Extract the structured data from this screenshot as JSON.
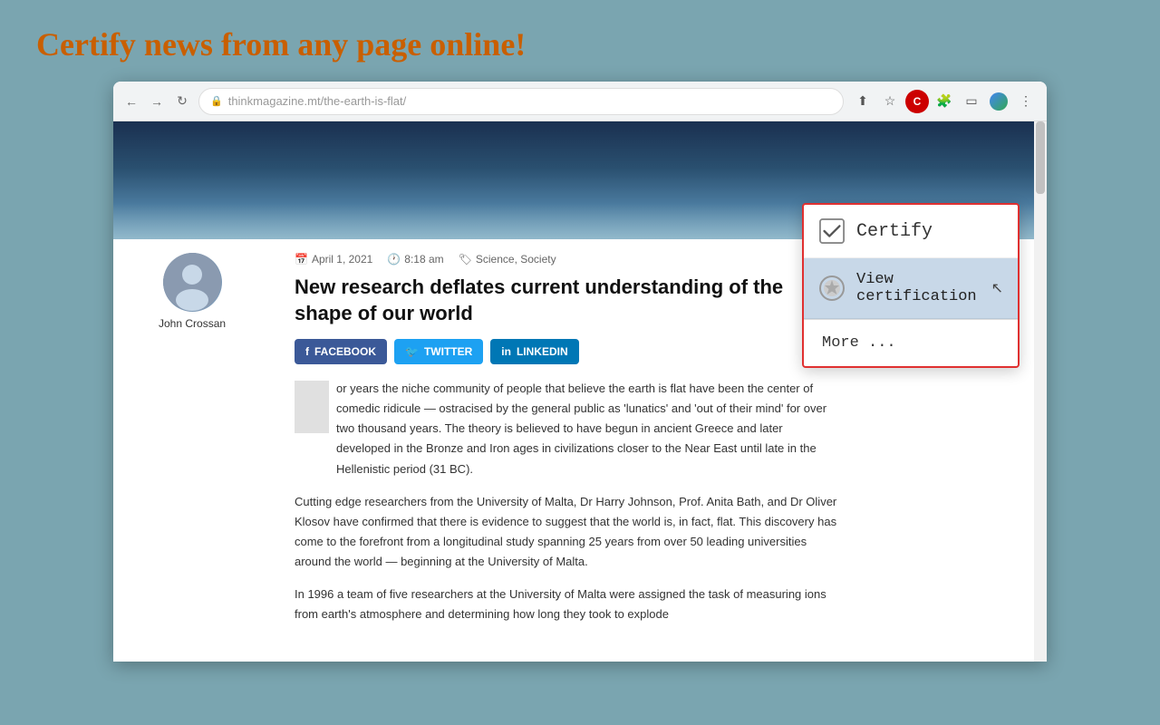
{
  "page": {
    "headline": "Certify news from any page online!"
  },
  "browser": {
    "back_label": "←",
    "forward_label": "→",
    "refresh_label": "↻",
    "address": "thinkmagazine.mt/the-earth-is-flat/",
    "address_prefix": "thinkmagazine.mt",
    "address_suffix": "/the-earth-is-flat/"
  },
  "article": {
    "author_name": "John Crossan",
    "date": "April 1, 2021",
    "time": "8:18 am",
    "categories": "Science, Society",
    "title": "New research deflates current understanding of the shape of our world",
    "share_buttons": [
      {
        "label": "FACEBOOK",
        "type": "facebook"
      },
      {
        "label": "TWITTER",
        "type": "twitter"
      },
      {
        "label": "LINKEDIN",
        "type": "linkedin"
      }
    ],
    "body_paragraphs": [
      "or years the niche community of people that believe the earth is flat have been the center of comedic ridicule — ostracised by the general public as 'lunatics' and 'out of their mind' for over two thousand years. The theory is believed to have begun in ancient Greece and later developed in the Bronze and Iron ages in civilizations closer to the Near East until late in the Hellenistic period (31 BC).",
      "Cutting edge researchers from the University of Malta, Dr Harry Johnson, Prof. Anita Bath, and Dr Oliver Klosov have confirmed that there is evidence to suggest that the world is, in fact, flat. This discovery has come to the forefront from a longitudinal study spanning 25 years from over 50 leading universities around the world — beginning at the University of Malta.",
      "In 1996 a team of five researchers at the University of Malta were assigned the task of measuring ions from earth's atmosphere and determining how long they took to explode"
    ]
  },
  "extension_popup": {
    "title": "Certify",
    "view_certification_label": "View certification",
    "more_label": "More ..."
  }
}
